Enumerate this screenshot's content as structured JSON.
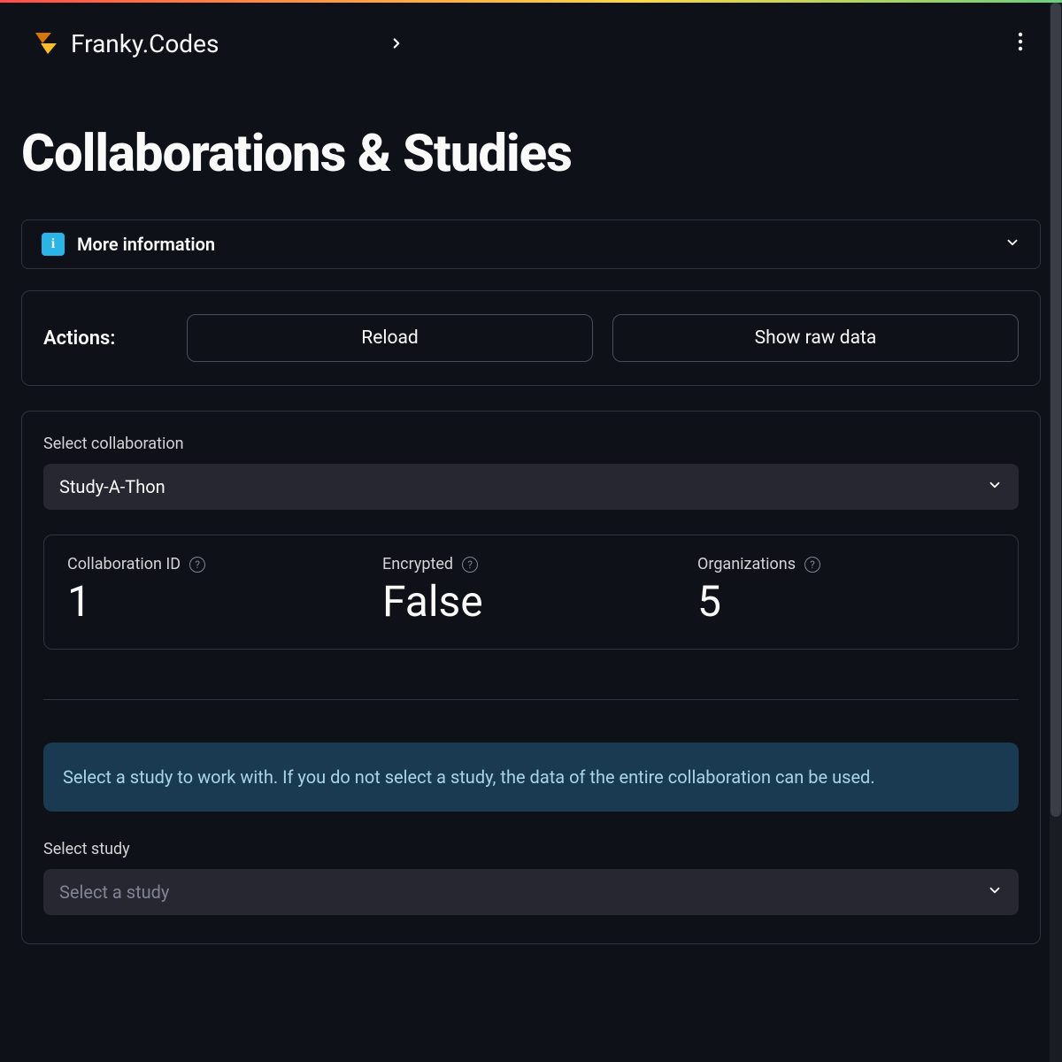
{
  "header": {
    "brand": "Franky.Codes"
  },
  "page": {
    "title": "Collaborations & Studies"
  },
  "expander": {
    "label": "More information"
  },
  "actions": {
    "label": "Actions:",
    "reload": "Reload",
    "show_raw": "Show raw data"
  },
  "collab": {
    "label": "Select collaboration",
    "selected": "Study-A-Thon"
  },
  "metrics": {
    "collab_id": {
      "label": "Collaboration ID",
      "value": "1"
    },
    "encrypted": {
      "label": "Encrypted",
      "value": "False"
    },
    "orgs": {
      "label": "Organizations",
      "value": "5"
    }
  },
  "info_banner": "Select a study to work with. If you do not select a study, the data of the entire collaboration can be used.",
  "study": {
    "label": "Select study",
    "placeholder": "Select a study"
  }
}
